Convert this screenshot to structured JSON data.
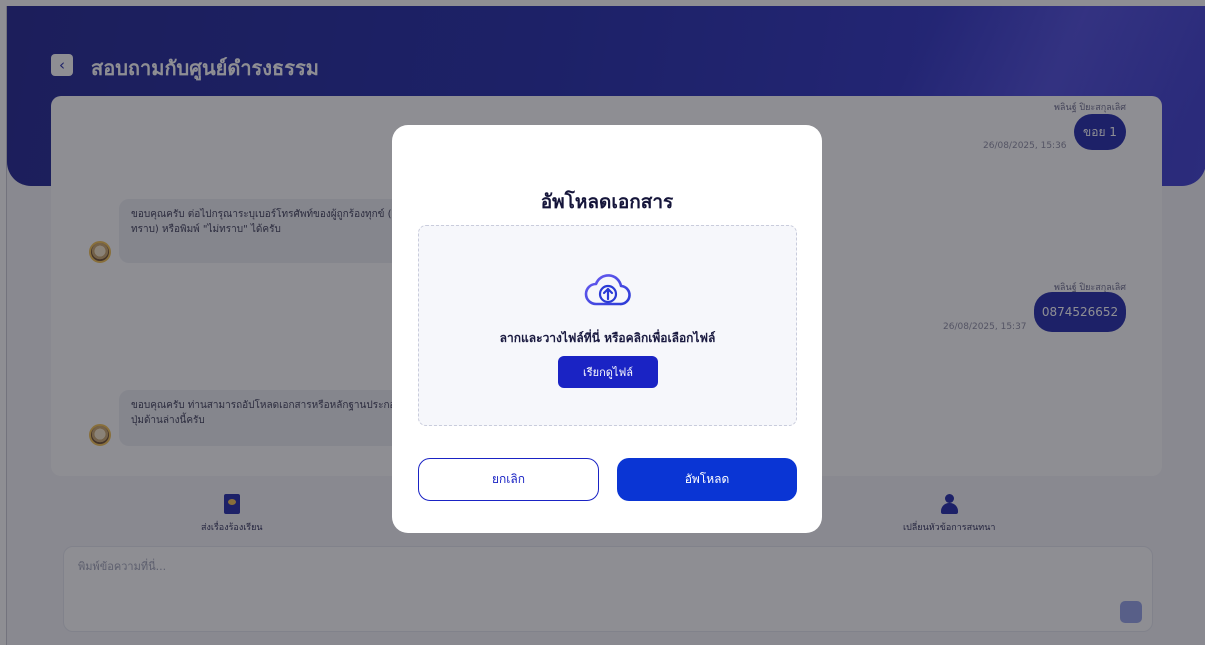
{
  "header": {
    "title": "สอบถามกับศูนย์ดำรงธรรม",
    "back_icon": "chevron-left-icon"
  },
  "chat": {
    "messages": [
      {
        "side": "right",
        "sender": "พลินฐ์ ปิยะสกุลเลิศ",
        "text": "ขอย 1",
        "time": "26/08/2025, 15:36"
      },
      {
        "side": "left",
        "text": "ขอบคุณครับ ต่อไปกรุณาระบุเบอร์โทรศัพท์ของผู้ถูกร้องทุกข์ (ถ้าทราบ) หรือพิมพ์ \"ไม่ทราบ\" ได้ครับ"
      },
      {
        "side": "right",
        "sender": "พลินฐ์ ปิยะสกุลเลิศ",
        "text": "0874526652",
        "time": "26/08/2025, 15:37"
      },
      {
        "side": "left",
        "text": "ขอบคุณครับ ท่านสามารถอัปโหลดเอกสารหรือหลักฐานประกอบได้ที่ปุ่มด้านล่างนี้ครับ"
      }
    ]
  },
  "actions": {
    "send_complaint": "ส่งเรื่องร้องเรียน",
    "change_topic": "เปลี่ยนหัวข้อการสนทนา"
  },
  "composer": {
    "placeholder": "พิมพ์ข้อความที่นี่..."
  },
  "modal": {
    "title": "อัพโหลดเอกสาร",
    "drop_text": "ลากและวางไฟล์ที่นี่ หรือคลิกเพื่อเลือกไฟล์",
    "browse_label": "เรียกดูไฟล์",
    "cancel_label": "ยกเลิก",
    "upload_label": "อัพโหลด"
  },
  "colors": {
    "brand": "#1c25a8",
    "primary_button": "#0a35d4"
  }
}
